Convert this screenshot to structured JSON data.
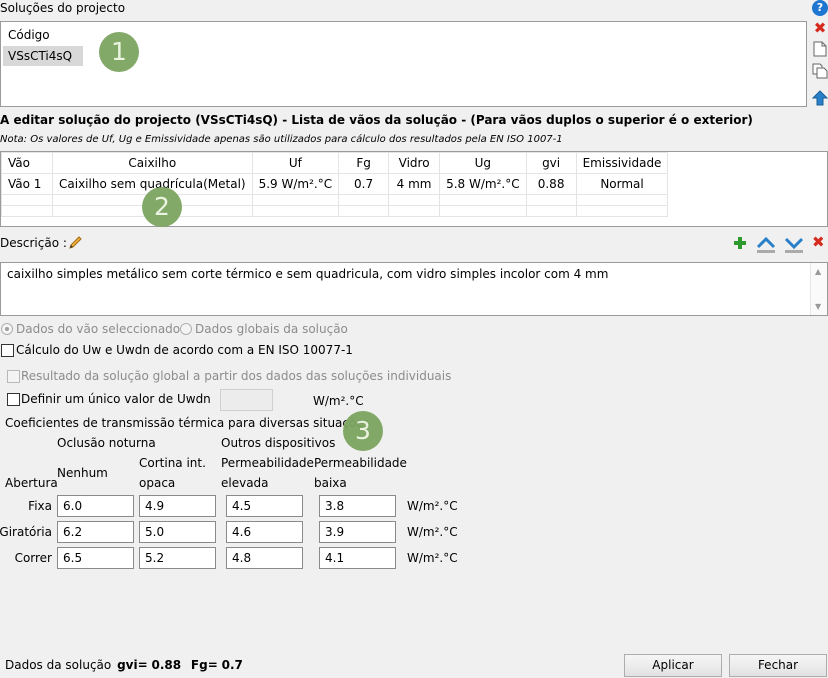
{
  "solutions": {
    "title": "Soluções do projecto",
    "column_header": "Código",
    "items": [
      "VSsCTi4sQ"
    ]
  },
  "side_icons": {
    "help": "help-icon",
    "delete": "close-icon",
    "new": "new-document-icon",
    "copy": "copy-document-icon",
    "up": "arrow-up-icon"
  },
  "editing": {
    "title": "A editar solução do projecto (VSsCTi4sQ) - Lista de vãos da solução - (Para vãos duplos o superior é o exterior)",
    "note": "Nota: Os valores de Uf, Ug e Emissividade apenas são utilizados para cálculo dos resultados pela EN ISO 1007-1"
  },
  "table": {
    "headers": [
      "Vão",
      "Caixilho",
      "Uf",
      "Fg",
      "Vidro",
      "Ug",
      "gvi",
      "Emissividade"
    ],
    "rows": [
      [
        "Vão 1",
        "Caixilho sem quadrícula(Metal)",
        "5.9 W/m².°C",
        "0.7",
        "4 mm",
        "5.8 W/m².°C",
        "0.88",
        "Normal"
      ]
    ]
  },
  "description": {
    "label": "Descrição :",
    "text": "caixilho simples metálico sem corte térmico e sem quadricula, com vidro simples incolor com 4 mm"
  },
  "options": {
    "radio_selected": "Dados do vão seleccionado",
    "radio_global": "Dados globais da solução",
    "calc_uw": "Cálculo do Uw e Uwdn de acordo com a EN ISO 10077-1",
    "global_result": "Resultado da solução global a partir dos dados das soluções individuais",
    "single_uwdn": "Definir um único valor de Uwdn",
    "uwdn_unit": "W/m².°C"
  },
  "coefficients": {
    "title": "Coeficientes de transmissão térmica para diversas situações",
    "group_night": "Oclusão noturna",
    "group_other": "Outros dispositivos",
    "col_opening": "Abertura",
    "col_none": "Nenhum",
    "col_curtain_1": "Cortina int.",
    "col_curtain_2": "opaca",
    "col_perm_high_1": "Permeabilidade",
    "col_perm_high_2": "elevada",
    "col_perm_low_1": "Permeabilidade",
    "col_perm_low_2": "baixa",
    "unit": "W/m².°C",
    "rows": [
      {
        "label": "Fixa",
        "values": [
          "6.0",
          "4.9",
          "4.5",
          "3.8"
        ]
      },
      {
        "label": "Giratória",
        "values": [
          "6.2",
          "5.0",
          "4.6",
          "3.9"
        ]
      },
      {
        "label": "Correr",
        "values": [
          "6.5",
          "5.2",
          "4.8",
          "4.1"
        ]
      }
    ]
  },
  "footer": {
    "summary_label": "Dados da solução",
    "gvi_label": "gvi=",
    "gvi_value": "0.88",
    "fg_label": "Fg=",
    "fg_value": "0.7",
    "apply": "Aplicar",
    "close": "Fechar"
  },
  "badges": [
    "1",
    "2",
    "3"
  ],
  "colors": {
    "badge": "#7da561",
    "delete": "#d52b1e",
    "help": "#1e76d0",
    "arrows": "#2a7fc9",
    "add": "#2e9a2e"
  }
}
